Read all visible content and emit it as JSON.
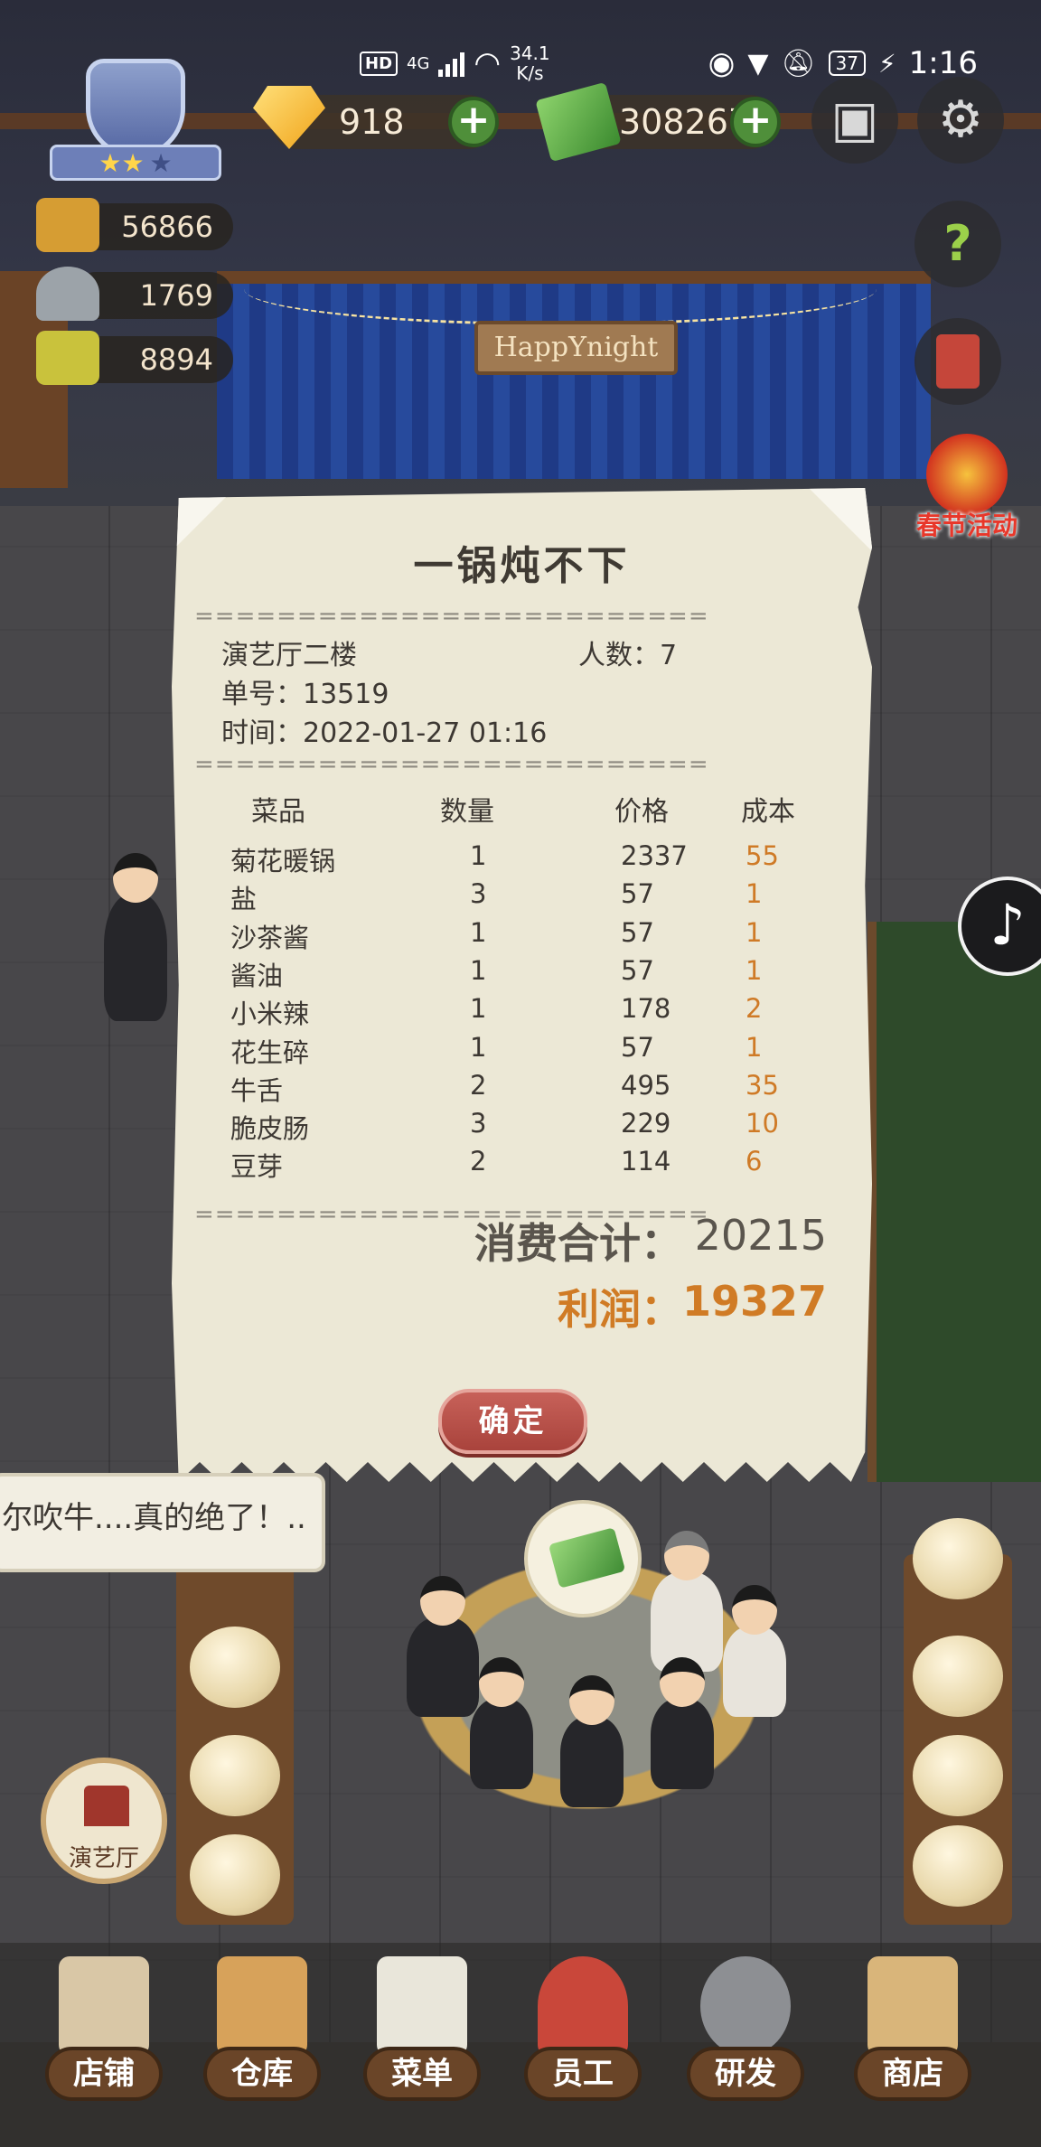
{
  "status_bar": {
    "hd": "HD",
    "network": "4G",
    "speed_value": "34.1",
    "speed_unit": "K/s",
    "battery": "37",
    "time": "1:16"
  },
  "hud": {
    "gems": "918",
    "cash": "308267",
    "plus": "+",
    "stats": [
      "56866",
      "1769",
      "8894"
    ],
    "spring_event": "春节活动",
    "stage_sign": "HappYnight"
  },
  "receipt": {
    "title": "一锅炖不下",
    "separator": "=========================",
    "hall": "演艺厅二楼",
    "people_label": "人数：",
    "people": "7",
    "order_label": "单号：",
    "order": "13519",
    "time_label": "时间：",
    "time": "2022-01-27 01:16",
    "headers": {
      "item": "菜品",
      "qty": "数量",
      "price": "价格",
      "cost": "成本"
    },
    "items": [
      {
        "name": "菊花暖锅",
        "qty": "1",
        "price": "2337",
        "cost": "55"
      },
      {
        "name": "盐",
        "qty": "3",
        "price": "57",
        "cost": "1"
      },
      {
        "name": "沙茶酱",
        "qty": "1",
        "price": "57",
        "cost": "1"
      },
      {
        "name": "酱油",
        "qty": "1",
        "price": "57",
        "cost": "1"
      },
      {
        "name": "小米辣",
        "qty": "1",
        "price": "178",
        "cost": "2"
      },
      {
        "name": "花生碎",
        "qty": "1",
        "price": "57",
        "cost": "1"
      },
      {
        "name": "牛舌",
        "qty": "2",
        "price": "495",
        "cost": "35"
      },
      {
        "name": "脆皮肠",
        "qty": "3",
        "price": "229",
        "cost": "10"
      },
      {
        "name": "豆芽",
        "qty": "2",
        "price": "114",
        "cost": "6"
      }
    ],
    "total_label": "消费合计：",
    "total": "20215",
    "profit_label": "利润：",
    "profit": "19327",
    "confirm": "确定"
  },
  "speech": "尔吹牛....真的绝了！..",
  "venue_button": "演艺厅",
  "nav": [
    "店铺",
    "仓库",
    "菜单",
    "员工",
    "研发",
    "商店"
  ],
  "colors": {
    "accent_cost": "#cf7a26",
    "profit": "#d07b25",
    "confirm_button": "#b44e46",
    "paper": "#ece8d6"
  }
}
